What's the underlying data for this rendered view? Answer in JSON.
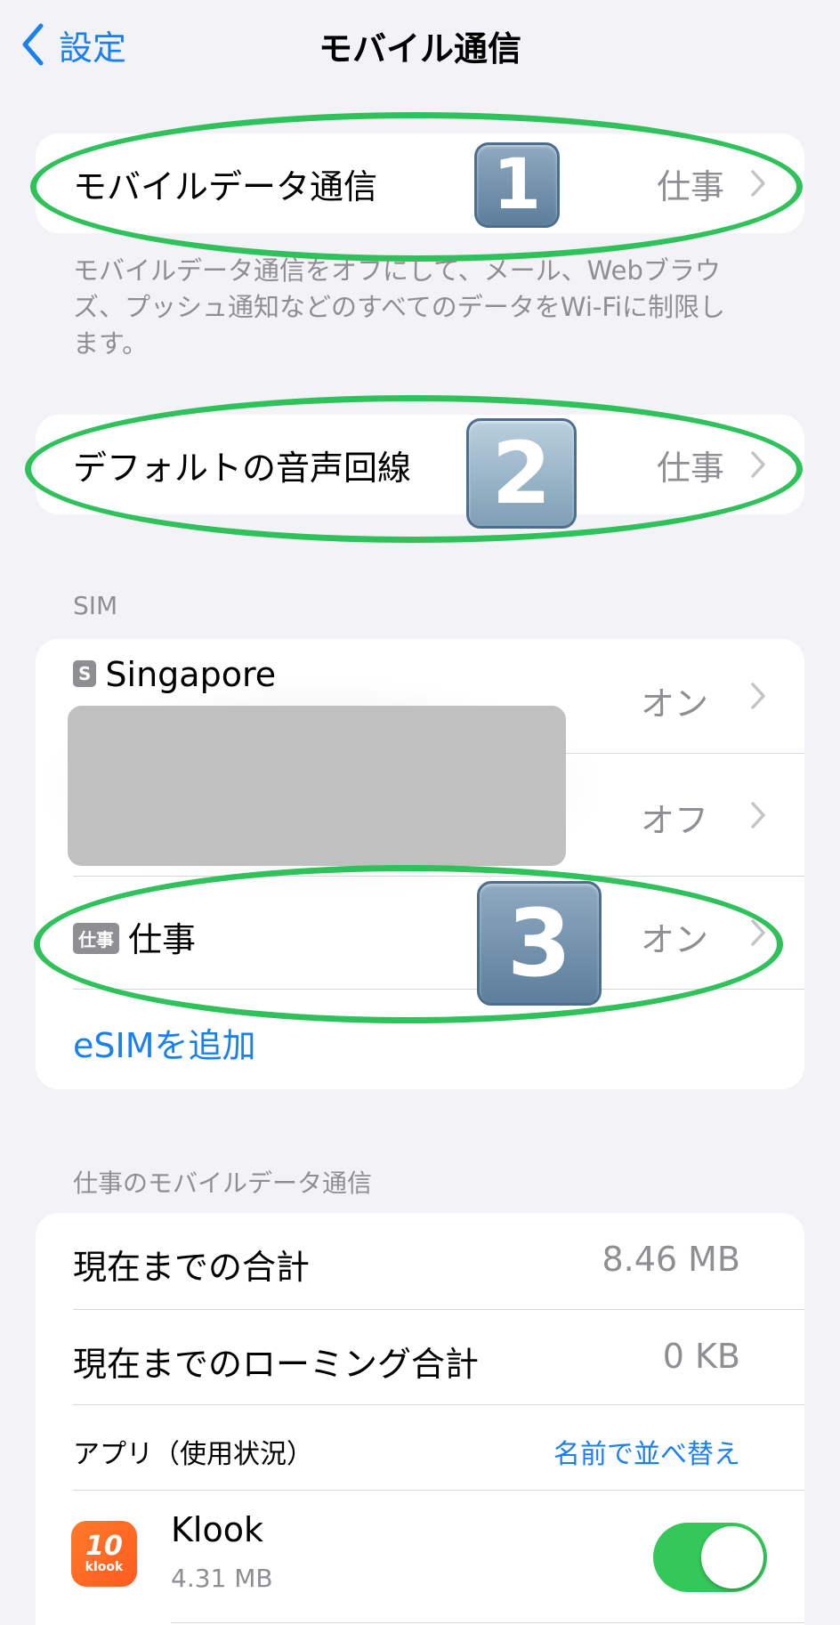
{
  "nav": {
    "back_label": "設定",
    "title": "モバイル通信"
  },
  "mobile_data": {
    "label": "モバイルデータ通信",
    "value": "仕事",
    "badge": "1"
  },
  "mobile_data_footnote": "モバイルデータ通信をオフにして、メール、Webブラウズ、プッシュ通知などのすべてのデータをWi-Fiに制限します。",
  "default_voice": {
    "label": "デフォルトの音声回線",
    "value": "仕事",
    "badge": "2"
  },
  "sim": {
    "header": "SIM",
    "rows": [
      {
        "tag": "S",
        "label": "Singapore",
        "value": "オン"
      },
      {
        "tag": "",
        "label": "",
        "value": "オフ"
      },
      {
        "tag": "仕事",
        "label": "仕事",
        "value": "オン",
        "badge": "3"
      }
    ],
    "add_esim": "eSIMを追加"
  },
  "usage": {
    "header": "仕事のモバイルデータ通信",
    "current_total_label": "現在までの合計",
    "current_total_value": "8.46 MB",
    "roaming_total_label": "現在までのローミング合計",
    "roaming_total_value": "0 KB",
    "apps_label": "アプリ（使用状況）",
    "sort_label": "名前で並べ替え",
    "apps": [
      {
        "name": "Klook",
        "size": "4.31 MB",
        "icon": "klook-icon",
        "icon_text_big": "10",
        "icon_text_small": "klook",
        "enabled": true
      }
    ]
  },
  "colors": {
    "accent": "#1a7ff0",
    "highlight_ellipse": "#2fc15a",
    "toggle_on": "#34c759"
  }
}
